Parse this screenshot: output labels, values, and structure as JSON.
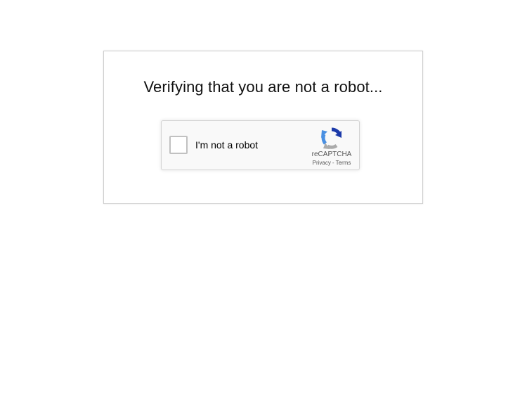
{
  "page": {
    "heading": "Verifying that you are not a robot..."
  },
  "recaptcha": {
    "checkbox_label": "I'm not a robot",
    "brand": "reCAPTCHA",
    "privacy_link": "Privacy",
    "separator": "-",
    "terms_link": "Terms",
    "checked": false,
    "logo_icon": "recaptcha-logo-icon",
    "colors": {
      "logo_blue_dark": "#1c3aa9",
      "logo_blue": "#4a90e2",
      "logo_gray": "#ababab"
    }
  }
}
